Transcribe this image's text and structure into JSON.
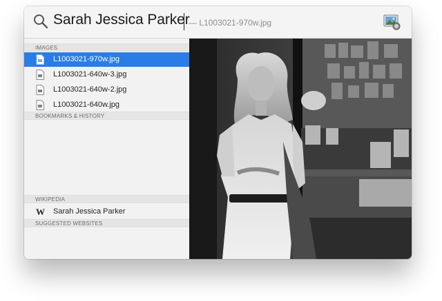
{
  "search": {
    "query": "Sarah Jessica Parker",
    "completion_hint": "— L1003021-970w.jpg"
  },
  "preview_app_icon": "preview-app-icon",
  "sections": {
    "images": {
      "header": "IMAGES",
      "items": [
        {
          "label": "L1003021-970w.jpg",
          "icon": "jpeg-file-icon",
          "selected": true
        },
        {
          "label": "L1003021-640w-3.jpg",
          "icon": "jpeg-file-icon",
          "selected": false
        },
        {
          "label": "L1003021-640w-2.jpg",
          "icon": "jpeg-file-icon",
          "selected": false
        },
        {
          "label": "L1003021-640w.jpg",
          "icon": "jpeg-file-icon",
          "selected": false
        }
      ]
    },
    "bookmarks": {
      "header": "BOOKMARKS & HISTORY"
    },
    "wikipedia": {
      "header": "WIKIPEDIA",
      "items": [
        {
          "label": "Sarah Jessica Parker",
          "icon": "wikipedia-icon"
        }
      ]
    },
    "suggested": {
      "header": "SUGGESTED WEBSITES"
    }
  },
  "colors": {
    "selection": "#2a7ce6",
    "panel_bg": "#f3f3f3",
    "section_header_bg": "#e5e5e5"
  }
}
